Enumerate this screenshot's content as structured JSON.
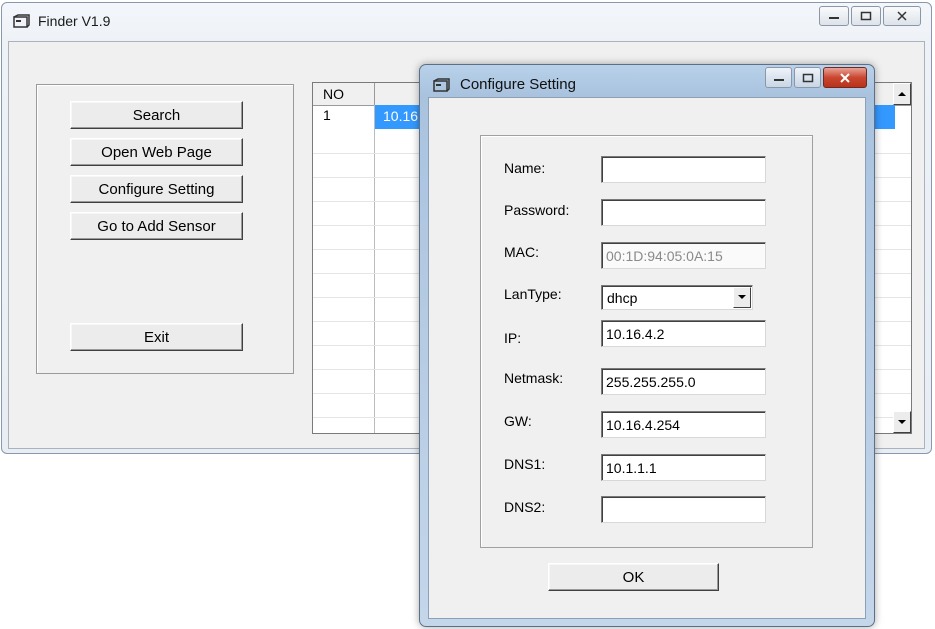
{
  "main_window": {
    "title": "Finder V1.9",
    "buttons": {
      "search": "Search",
      "open_web_page": "Open Web Page",
      "configure_setting": "Configure Setting",
      "go_to_add_sensor": "Go to Add Sensor",
      "exit": "Exit"
    },
    "device_list": {
      "columns": [
        "NO",
        ""
      ],
      "rows": [
        {
          "no": "1",
          "ip": "10.16."
        }
      ]
    }
  },
  "dialog": {
    "title": "Configure Setting",
    "fields": {
      "name": {
        "label": "Name:",
        "value": ""
      },
      "password": {
        "label": "Password:",
        "value": ""
      },
      "mac": {
        "label": "MAC:",
        "value": "00:1D:94:05:0A:15"
      },
      "lantype": {
        "label": "LanType:",
        "value": "dhcp"
      },
      "ip": {
        "label": "IP:",
        "value": "10.16.4.2"
      },
      "netmask": {
        "label": "Netmask:",
        "value": "255.255.255.0"
      },
      "gw": {
        "label": "GW:",
        "value": "10.16.4.254"
      },
      "dns1": {
        "label": "DNS1:",
        "value": "10.1.1.1"
      },
      "dns2": {
        "label": "DNS2:",
        "value": ""
      }
    },
    "ok_label": "OK"
  },
  "colors": {
    "selection": "#3399ff",
    "dialog_frame": "#a9c3df",
    "close_button": "#c9462f"
  },
  "icons": [
    "window-app-icon",
    "minimize-icon",
    "maximize-icon",
    "close-icon",
    "scroll-up-icon",
    "scroll-down-icon",
    "dropdown-arrow-icon"
  ]
}
